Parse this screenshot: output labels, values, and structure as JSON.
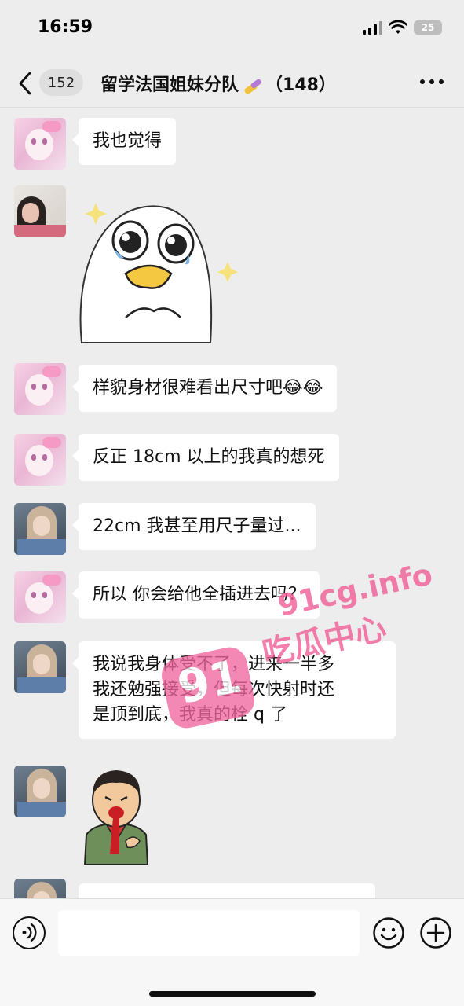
{
  "status_bar": {
    "time": "16:59",
    "battery": "25"
  },
  "header": {
    "unread_count": "152",
    "title": "留学法国姐妹分队",
    "member_count": "（148）"
  },
  "messages": [
    {
      "sender": "pink-anime",
      "type": "text",
      "lines": [
        "我也觉得"
      ]
    },
    {
      "sender": "girl-1",
      "type": "sticker",
      "sticker": "crying-duck-sticker"
    },
    {
      "sender": "pink-anime",
      "type": "text",
      "lines": [
        "样貌身材很难看出尺寸吧😂😂"
      ]
    },
    {
      "sender": "pink-anime",
      "type": "text",
      "lines": [
        "反正 18cm 以上的我真的想死"
      ]
    },
    {
      "sender": "girl-2",
      "type": "text",
      "lines": [
        "22cm 我甚至用尺子量过..."
      ]
    },
    {
      "sender": "pink-anime",
      "type": "text",
      "lines": [
        "所以 你会给他全插进去吗？"
      ]
    },
    {
      "sender": "girl-2",
      "type": "text",
      "lines": [
        "我说我身体受不了，进来一半多",
        "我还勉强接受，但每次快射时还",
        "是顶到底，我真的栓 q 了"
      ]
    },
    {
      "sender": "girl-2",
      "type": "sticker",
      "sticker": "bleeding-boy-sticker"
    },
    {
      "sender": "girl-2",
      "type": "text",
      "lines": [
        ""
      ]
    }
  ],
  "watermark": {
    "site": "91cg.info",
    "badge": "91",
    "label": "吃瓜中心"
  },
  "input": {
    "placeholder": ""
  }
}
